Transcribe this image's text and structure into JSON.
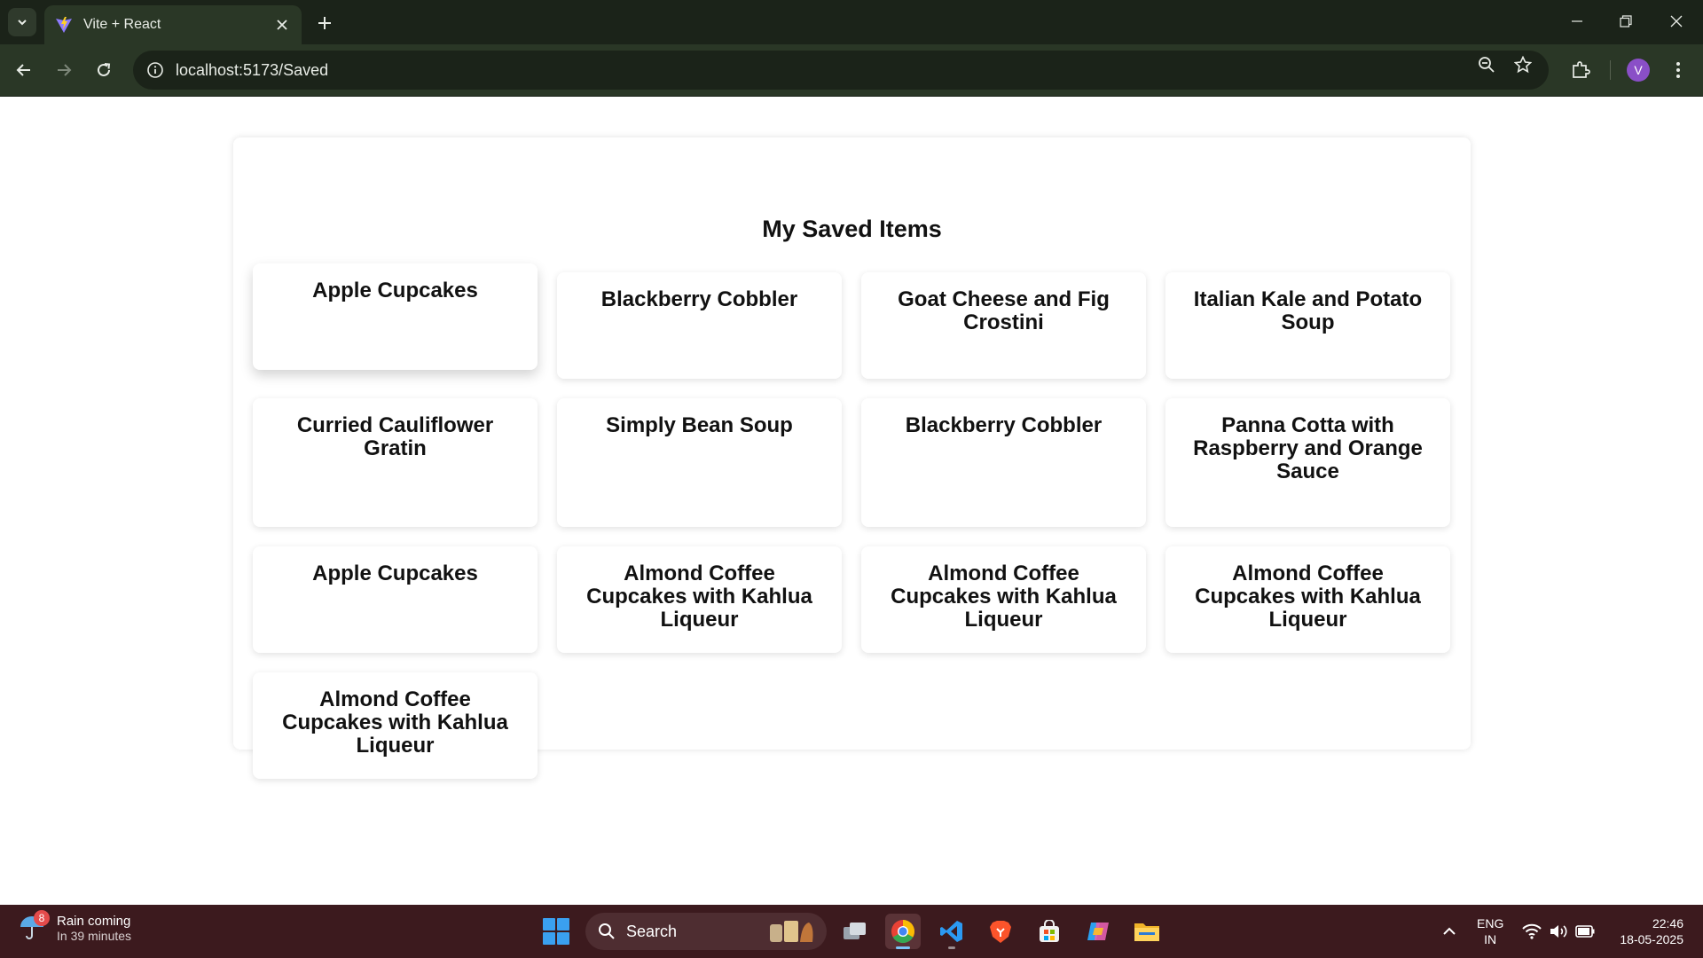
{
  "browser": {
    "tab_title": "Vite + React",
    "url": "localhost:5173/Saved",
    "profile_initial": "V"
  },
  "page": {
    "heading": "My Saved Items",
    "items": [
      "Apple Cupcakes",
      "Blackberry Cobbler",
      "Goat Cheese and Fig Crostini",
      "Italian Kale and Potato Soup",
      "Curried Cauliflower Gratin",
      "Simply Bean Soup",
      "Blackberry Cobbler",
      "Panna Cotta with Raspberry and Orange Sauce",
      "Apple Cupcakes",
      "Almond Coffee Cupcakes with Kahlua Liqueur",
      "Almond Coffee Cupcakes with Kahlua Liqueur",
      "Almond Coffee Cupcakes with Kahlua Liqueur",
      "Almond Coffee Cupcakes with Kahlua Liqueur"
    ]
  },
  "taskbar": {
    "weather_title": "Rain coming",
    "weather_sub": "In 39 minutes",
    "weather_badge": "8",
    "search_placeholder": "Search",
    "lang_line1": "ENG",
    "lang_line2": "IN",
    "time": "22:46",
    "date": "18-05-2025"
  },
  "colors": {
    "chrome_dark": "#1b2319",
    "chrome_toolbar": "#2a3726",
    "taskbar": "#3c1a1e",
    "accent_avatar": "#8a4fc7"
  }
}
